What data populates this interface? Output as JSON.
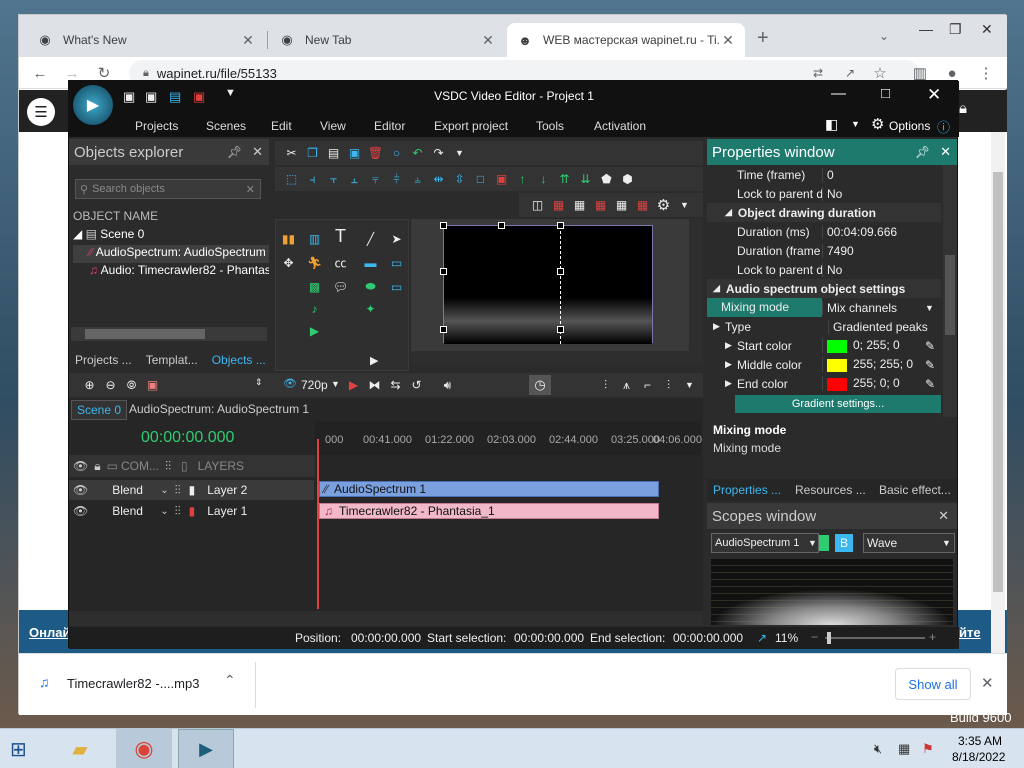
{
  "browser": {
    "tabs": [
      {
        "title": "What's New",
        "icon": "chrome-icon"
      },
      {
        "title": "New Tab",
        "icon": "chrome-icon"
      },
      {
        "title": "WEB мастерская wapinet.ru - Ti...",
        "icon": "wapinet-icon"
      }
    ],
    "url": "wapinet.ru/file/55133",
    "page_link_left": "Онлай",
    "page_link_right": "йте"
  },
  "app": {
    "title": "VSDC Video Editor - Project 1",
    "menu": [
      "Projects",
      "Scenes",
      "Edit",
      "View",
      "Editor",
      "Export project",
      "Tools",
      "Activation"
    ],
    "options_label": "Options",
    "objects_explorer": {
      "title": "Objects explorer",
      "search_placeholder": "Search objects",
      "column": "OBJECT NAME",
      "tree": [
        "Scene 0",
        "AudioSpectrum: AudioSpectrum",
        "Audio: Timecrawler82 - Phantas"
      ],
      "bottom_tabs": [
        "Projects ...",
        "Templat...",
        "Objects ..."
      ]
    },
    "resolution": "720p",
    "timeline": {
      "tabs": [
        "Scene 0",
        "AudioSpectrum: AudioSpectrum 1"
      ],
      "time": "00:00:00.000",
      "ruler": [
        "000",
        "00:41.000",
        "01:22.000",
        "02:03.000",
        "02:44.000",
        "03:25.000",
        "04:06.000"
      ],
      "header_com": "COM...",
      "header_layers": "LAYERS",
      "rows": [
        {
          "blend": "Blend",
          "layer": "Layer 2",
          "clip": "AudioSpectrum 1"
        },
        {
          "blend": "Blend",
          "layer": "Layer 1",
          "clip": "Timecrawler82 - Phantasia_1"
        }
      ]
    },
    "status": {
      "position_label": "Position:",
      "position": "00:00:00.000",
      "start_label": "Start selection:",
      "start": "00:00:00.000",
      "end_label": "End selection:",
      "end": "00:00:00.000",
      "zoom": "11%"
    },
    "properties": {
      "title": "Properties window",
      "rows": [
        {
          "k": "Time (frame)",
          "v": "0"
        },
        {
          "k": "Lock to parent d",
          "v": "No"
        }
      ],
      "section1": "Object drawing duration",
      "rows2": [
        {
          "k": "Duration (ms)",
          "v": "00:04:09.666"
        },
        {
          "k": "Duration (frame",
          "v": "7490"
        },
        {
          "k": "Lock to parent d",
          "v": "No"
        }
      ],
      "section2": "Audio spectrum object settings",
      "mixing_mode_k": "Mixing mode",
      "mixing_mode_v": "Mix channels",
      "type_k": "Type",
      "type_v": "Gradiented peaks",
      "colors": [
        {
          "k": "Start color",
          "v": "0; 255; 0",
          "hex": "#00ff00"
        },
        {
          "k": "Middle color",
          "v": "255; 255; 0",
          "hex": "#ffff00"
        },
        {
          "k": "End color",
          "v": "255; 0; 0",
          "hex": "#ff0000"
        }
      ],
      "gradient_button": "Gradient settings...",
      "desc_title": "Mixing mode",
      "desc_text": "Mixing mode",
      "tabs": [
        "Properties ...",
        "Resources ...",
        "Basic effect..."
      ]
    },
    "scopes": {
      "title": "Scopes window",
      "source": "AudioSpectrum 1",
      "b_label": "B",
      "mode": "Wave"
    }
  },
  "download": {
    "file": "Timecrawler82 -....mp3",
    "show_all": "Show all"
  },
  "taskbar": {
    "time": "3:35 AM",
    "date": "8/18/2022",
    "build": "Build 9600"
  }
}
